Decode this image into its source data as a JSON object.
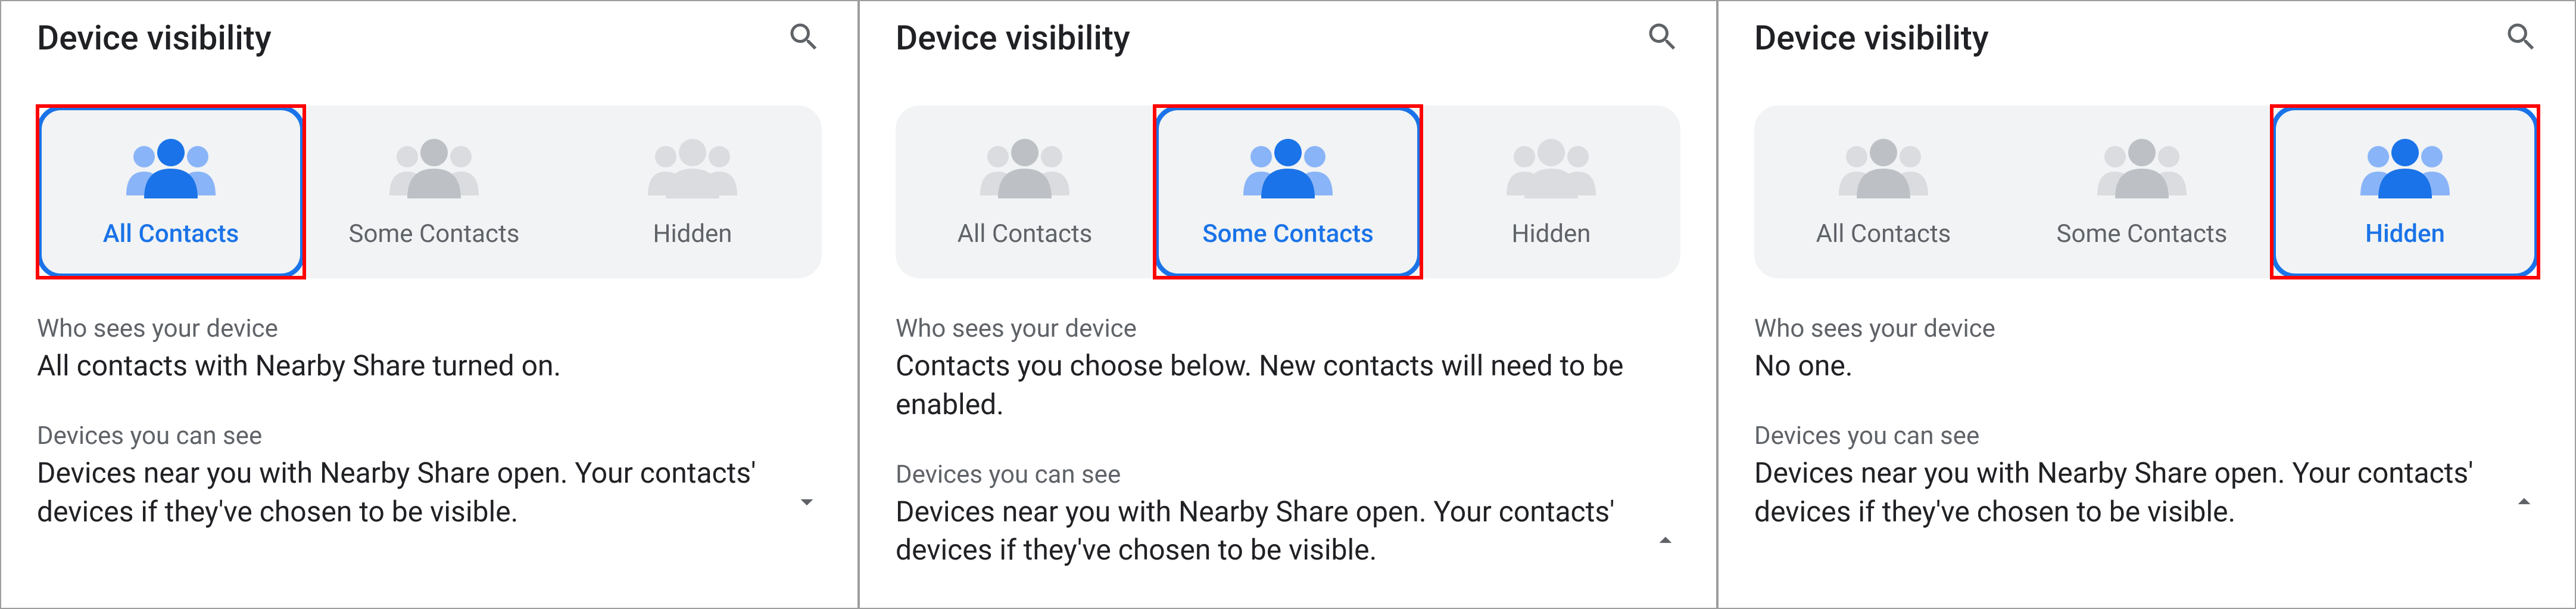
{
  "panels": [
    {
      "title": "Device visibility",
      "options": {
        "all": {
          "label": "All Contacts",
          "selected": true,
          "highlighted": true
        },
        "some": {
          "label": "Some Contacts",
          "selected": false,
          "highlighted": false
        },
        "hidden": {
          "label": "Hidden",
          "selected": false,
          "highlighted": false
        }
      },
      "who_label": "Who sees your device",
      "who_text": "All contacts with Nearby Share turned on.",
      "devices_label": "Devices you can see",
      "devices_text": "Devices near you with Nearby Share open. Your contacts' devices if they've chosen to be visible.",
      "chevron": "down"
    },
    {
      "title": "Device visibility",
      "options": {
        "all": {
          "label": "All Contacts",
          "selected": false,
          "highlighted": false
        },
        "some": {
          "label": "Some Contacts",
          "selected": true,
          "highlighted": true
        },
        "hidden": {
          "label": "Hidden",
          "selected": false,
          "highlighted": false
        }
      },
      "who_label": "Who sees your device",
      "who_text": "Contacts you choose below. New contacts will need to be enabled.",
      "devices_label": "Devices you can see",
      "devices_text": "Devices near you with Nearby Share open. Your contacts' devices if they've chosen to be visible.",
      "chevron": "up"
    },
    {
      "title": "Device visibility",
      "options": {
        "all": {
          "label": "All Contacts",
          "selected": false,
          "highlighted": false
        },
        "some": {
          "label": "Some Contacts",
          "selected": false,
          "highlighted": false
        },
        "hidden": {
          "label": "Hidden",
          "selected": true,
          "highlighted": true
        }
      },
      "who_label": "Who sees your device",
      "who_text": "No one.",
      "devices_label": "Devices you can see",
      "devices_text": "Devices near you with Nearby Share open. Your contacts' devices if they've chosen to be visible.",
      "chevron": "up"
    }
  ]
}
